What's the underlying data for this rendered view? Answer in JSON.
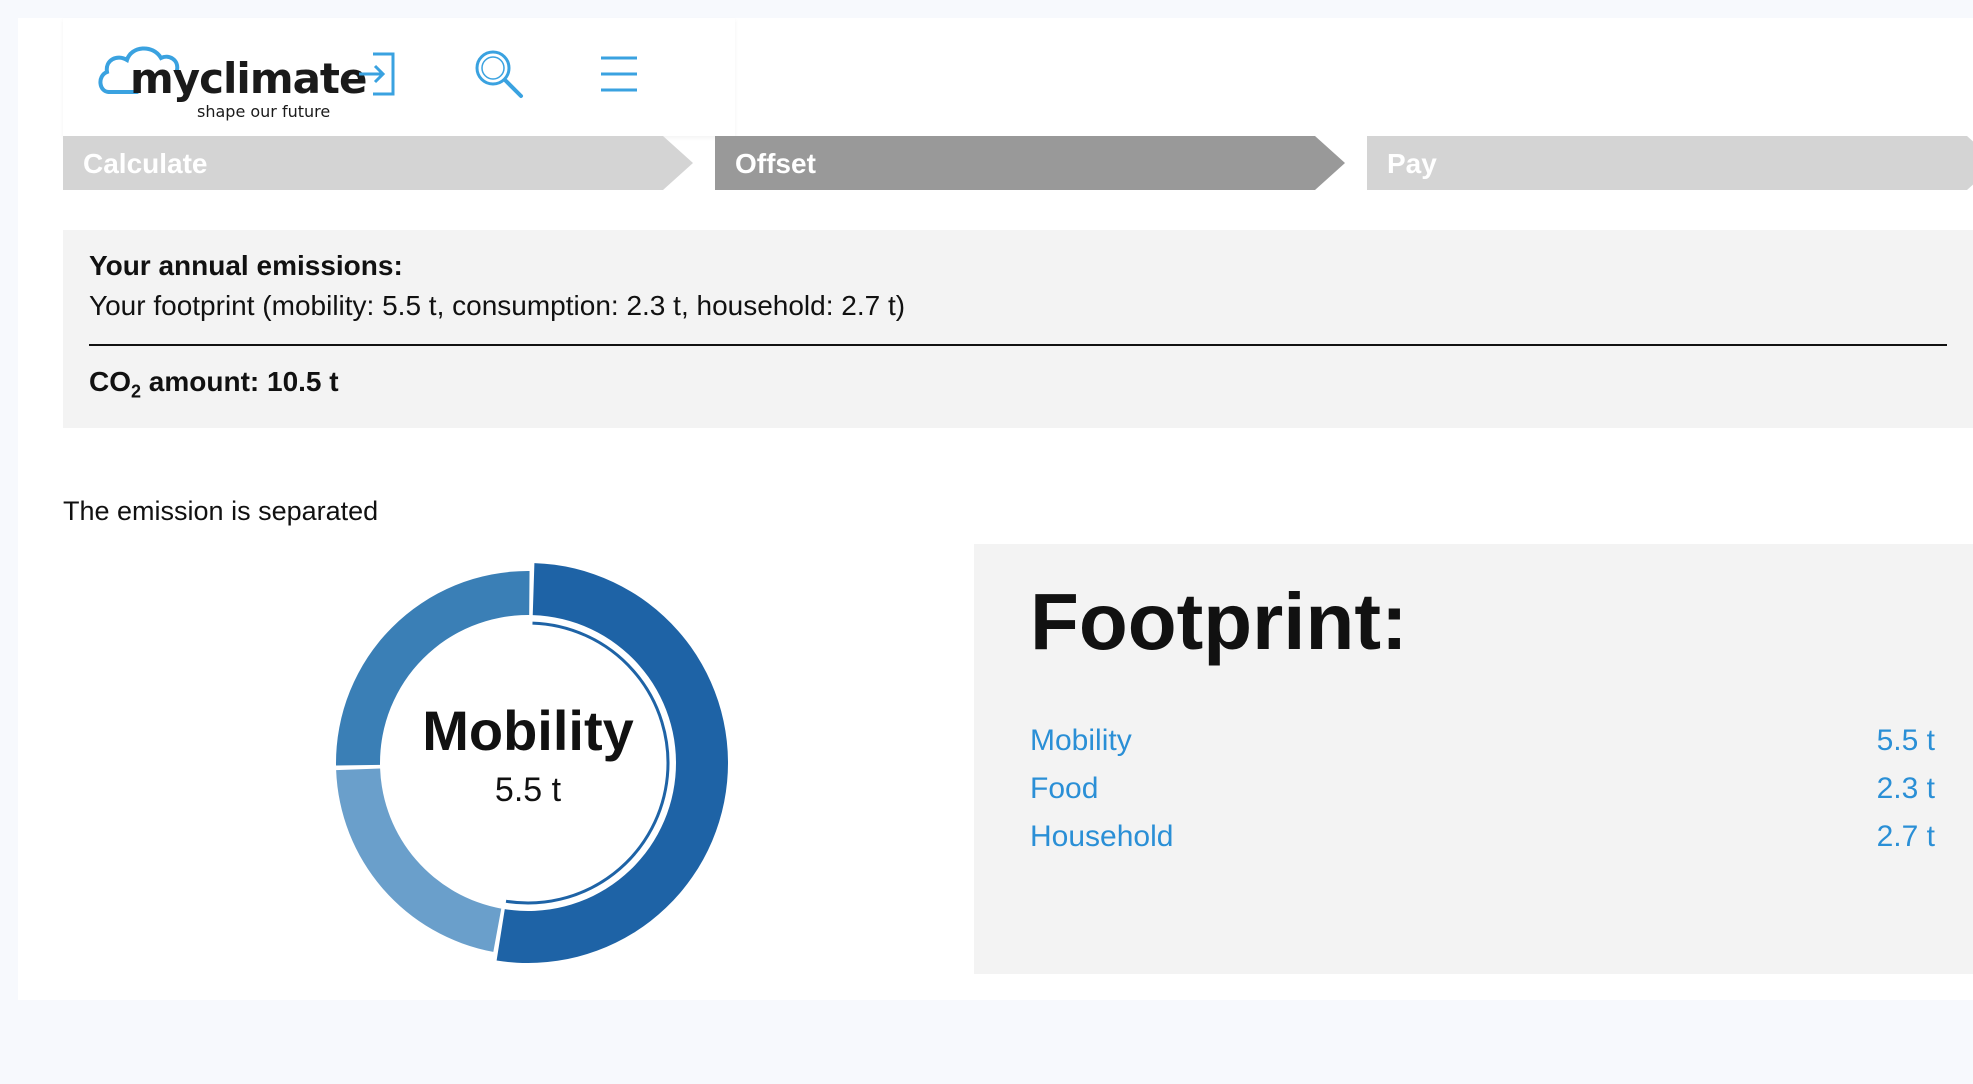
{
  "header": {
    "logo": {
      "word": "myclimate",
      "tagline": "shape our future"
    },
    "icons": [
      "login-icon",
      "search-icon",
      "menu-icon"
    ]
  },
  "steps": [
    {
      "label": "Calculate",
      "state": "inactive"
    },
    {
      "label": "Offset",
      "state": "active"
    },
    {
      "label": "Pay",
      "state": "inactive"
    }
  ],
  "summary": {
    "heading": "Your annual emissions:",
    "detail": "Your footprint (mobility: 5.5 t, consumption: 2.3 t, household: 2.7 t)",
    "co2_prefix": "CO",
    "co2_sub": "2",
    "co2_suffix": " amount: 10.5 t"
  },
  "separated_text": "The emission is separated",
  "chart_data": {
    "type": "pie",
    "categories": [
      "Mobility",
      "Food",
      "Household"
    ],
    "values": [
      5.5,
      2.3,
      2.7
    ],
    "colors": [
      "#1e63a6",
      "#6a9fcb",
      "#3a7fb6"
    ],
    "highlight": {
      "label": "Mobility",
      "value": "5.5 t"
    }
  },
  "footprint": {
    "title": "Footprint:",
    "items": [
      {
        "label": "Mobility",
        "value": "5.5 t"
      },
      {
        "label": "Food",
        "value": "2.3 t"
      },
      {
        "label": "Household",
        "value": "2.7 t"
      }
    ]
  },
  "colors": {
    "accent": "#2a8fd6",
    "step_active": "#999999",
    "step_inactive": "#d4d4d4",
    "panel": "#f3f3f3"
  }
}
